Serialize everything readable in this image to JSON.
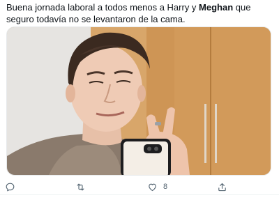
{
  "tweet": {
    "text_before": "Buena jornada laboral a todos menos a Harry y ",
    "text_bold": "Meghan",
    "text_after": " que seguro todavía no se levantaron de la cama."
  },
  "actions": {
    "reply": {
      "icon": "reply-icon",
      "count": ""
    },
    "retweet": {
      "icon": "retweet-icon",
      "count": ""
    },
    "like": {
      "icon": "heart-icon",
      "count": "8"
    },
    "share": {
      "icon": "share-icon",
      "count": ""
    }
  },
  "colors": {
    "text": "#0f1419",
    "muted": "#536471",
    "background": "#ffffff"
  }
}
